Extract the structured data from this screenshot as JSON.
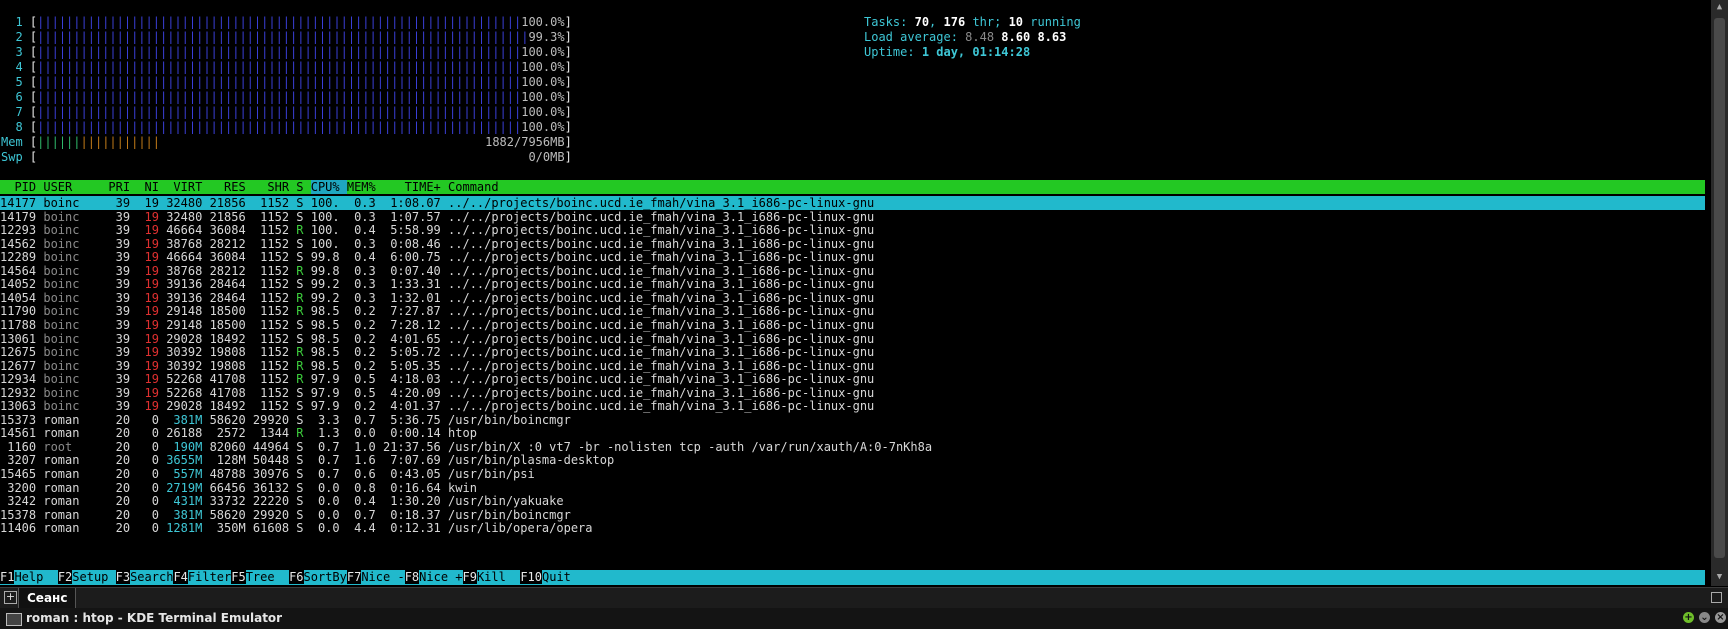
{
  "cpus": [
    {
      "id": "1",
      "pct": "100.0%"
    },
    {
      "id": "2",
      "pct": "99.3%"
    },
    {
      "id": "3",
      "pct": "100.0%"
    },
    {
      "id": "4",
      "pct": "100.0%"
    },
    {
      "id": "5",
      "pct": "100.0%"
    },
    {
      "id": "6",
      "pct": "100.0%"
    },
    {
      "id": "7",
      "pct": "100.0%"
    },
    {
      "id": "8",
      "pct": "100.0%"
    }
  ],
  "mem": {
    "label": "Mem",
    "value": "1882/7956MB",
    "fraction": 0.2366
  },
  "swp": {
    "label": "Swp",
    "value": "0/0MB",
    "fraction": 0
  },
  "summary": {
    "tasks_label": "Tasks:",
    "tasks": "70",
    "thr_sep": ",",
    "thr": "176",
    "thr_label": "thr;",
    "running": "10",
    "running_label": "running",
    "load_label": "Load average:",
    "load1": "8.48",
    "load5": "8.60",
    "load15": "8.63",
    "uptime_label": "Uptime:",
    "uptime": "1 day, 01:14:28"
  },
  "columns": [
    "PID",
    "USER",
    "PRI",
    "NI",
    "VIRT",
    "RES",
    "SHR",
    "S",
    "CPU%",
    "MEM%",
    "TIME+",
    "Command"
  ],
  "processes": [
    {
      "pid": "14177",
      "user": "boinc",
      "pri": "39",
      "ni": "19",
      "virt": "32480",
      "res": "21856",
      "shr": "1152",
      "s": "S",
      "cpu": "100.",
      "mem": "0.3",
      "time": "1:08.07",
      "cmd": "../../projects/boinc.ucd.ie_fmah/vina_3.1_i686-pc-linux-gnu"
    },
    {
      "pid": "14179",
      "user": "boinc",
      "pri": "39",
      "ni": "19",
      "virt": "32480",
      "res": "21856",
      "shr": "1152",
      "s": "S",
      "cpu": "100.",
      "mem": "0.3",
      "time": "1:07.57",
      "cmd": "../../projects/boinc.ucd.ie_fmah/vina_3.1_i686-pc-linux-gnu"
    },
    {
      "pid": "12293",
      "user": "boinc",
      "pri": "39",
      "ni": "19",
      "virt": "46664",
      "res": "36084",
      "shr": "1152",
      "s": "R",
      "cpu": "100.",
      "mem": "0.4",
      "time": "5:58.99",
      "cmd": "../../projects/boinc.ucd.ie_fmah/vina_3.1_i686-pc-linux-gnu"
    },
    {
      "pid": "14562",
      "user": "boinc",
      "pri": "39",
      "ni": "19",
      "virt": "38768",
      "res": "28212",
      "shr": "1152",
      "s": "S",
      "cpu": "100.",
      "mem": "0.3",
      "time": "0:08.46",
      "cmd": "../../projects/boinc.ucd.ie_fmah/vina_3.1_i686-pc-linux-gnu"
    },
    {
      "pid": "12289",
      "user": "boinc",
      "pri": "39",
      "ni": "19",
      "virt": "46664",
      "res": "36084",
      "shr": "1152",
      "s": "S",
      "cpu": "99.8",
      "mem": "0.4",
      "time": "6:00.75",
      "cmd": "../../projects/boinc.ucd.ie_fmah/vina_3.1_i686-pc-linux-gnu"
    },
    {
      "pid": "14564",
      "user": "boinc",
      "pri": "39",
      "ni": "19",
      "virt": "38768",
      "res": "28212",
      "shr": "1152",
      "s": "R",
      "cpu": "99.8",
      "mem": "0.3",
      "time": "0:07.40",
      "cmd": "../../projects/boinc.ucd.ie_fmah/vina_3.1_i686-pc-linux-gnu"
    },
    {
      "pid": "14052",
      "user": "boinc",
      "pri": "39",
      "ni": "19",
      "virt": "39136",
      "res": "28464",
      "shr": "1152",
      "s": "S",
      "cpu": "99.2",
      "mem": "0.3",
      "time": "1:33.31",
      "cmd": "../../projects/boinc.ucd.ie_fmah/vina_3.1_i686-pc-linux-gnu"
    },
    {
      "pid": "14054",
      "user": "boinc",
      "pri": "39",
      "ni": "19",
      "virt": "39136",
      "res": "28464",
      "shr": "1152",
      "s": "R",
      "cpu": "99.2",
      "mem": "0.3",
      "time": "1:32.01",
      "cmd": "../../projects/boinc.ucd.ie_fmah/vina_3.1_i686-pc-linux-gnu"
    },
    {
      "pid": "11790",
      "user": "boinc",
      "pri": "39",
      "ni": "19",
      "virt": "29148",
      "res": "18500",
      "shr": "1152",
      "s": "R",
      "cpu": "98.5",
      "mem": "0.2",
      "time": "7:27.87",
      "cmd": "../../projects/boinc.ucd.ie_fmah/vina_3.1_i686-pc-linux-gnu"
    },
    {
      "pid": "11788",
      "user": "boinc",
      "pri": "39",
      "ni": "19",
      "virt": "29148",
      "res": "18500",
      "shr": "1152",
      "s": "S",
      "cpu": "98.5",
      "mem": "0.2",
      "time": "7:28.12",
      "cmd": "../../projects/boinc.ucd.ie_fmah/vina_3.1_i686-pc-linux-gnu"
    },
    {
      "pid": "13061",
      "user": "boinc",
      "pri": "39",
      "ni": "19",
      "virt": "29028",
      "res": "18492",
      "shr": "1152",
      "s": "S",
      "cpu": "98.5",
      "mem": "0.2",
      "time": "4:01.65",
      "cmd": "../../projects/boinc.ucd.ie_fmah/vina_3.1_i686-pc-linux-gnu"
    },
    {
      "pid": "12675",
      "user": "boinc",
      "pri": "39",
      "ni": "19",
      "virt": "30392",
      "res": "19808",
      "shr": "1152",
      "s": "R",
      "cpu": "98.5",
      "mem": "0.2",
      "time": "5:05.72",
      "cmd": "../../projects/boinc.ucd.ie_fmah/vina_3.1_i686-pc-linux-gnu"
    },
    {
      "pid": "12677",
      "user": "boinc",
      "pri": "39",
      "ni": "19",
      "virt": "30392",
      "res": "19808",
      "shr": "1152",
      "s": "R",
      "cpu": "98.5",
      "mem": "0.2",
      "time": "5:05.35",
      "cmd": "../../projects/boinc.ucd.ie_fmah/vina_3.1_i686-pc-linux-gnu"
    },
    {
      "pid": "12934",
      "user": "boinc",
      "pri": "39",
      "ni": "19",
      "virt": "52268",
      "res": "41708",
      "shr": "1152",
      "s": "R",
      "cpu": "97.9",
      "mem": "0.5",
      "time": "4:18.03",
      "cmd": "../../projects/boinc.ucd.ie_fmah/vina_3.1_i686-pc-linux-gnu"
    },
    {
      "pid": "12932",
      "user": "boinc",
      "pri": "39",
      "ni": "19",
      "virt": "52268",
      "res": "41708",
      "shr": "1152",
      "s": "S",
      "cpu": "97.9",
      "mem": "0.5",
      "time": "4:20.09",
      "cmd": "../../projects/boinc.ucd.ie_fmah/vina_3.1_i686-pc-linux-gnu"
    },
    {
      "pid": "13063",
      "user": "boinc",
      "pri": "39",
      "ni": "19",
      "virt": "29028",
      "res": "18492",
      "shr": "1152",
      "s": "S",
      "cpu": "97.9",
      "mem": "0.2",
      "time": "4:01.37",
      "cmd": "../../projects/boinc.ucd.ie_fmah/vina_3.1_i686-pc-linux-gnu"
    },
    {
      "pid": "15373",
      "user": "roman",
      "pri": "20",
      "ni": "0",
      "virt": "381M",
      "res": "58620",
      "shr": "29920",
      "s": "S",
      "cpu": "3.3",
      "mem": "0.7",
      "time": "5:36.75",
      "cmd": "/usr/bin/boincmgr"
    },
    {
      "pid": "14561",
      "user": "roman",
      "pri": "20",
      "ni": "0",
      "virt": "26188",
      "res": "2572",
      "shr": "1344",
      "s": "R",
      "cpu": "1.3",
      "mem": "0.0",
      "time": "0:00.14",
      "cmd": "htop"
    },
    {
      "pid": "1160",
      "user": "root",
      "pri": "20",
      "ni": "0",
      "virt": "190M",
      "res": "82060",
      "shr": "44964",
      "s": "S",
      "cpu": "0.7",
      "mem": "1.0",
      "time": "21:37.56",
      "cmd": "/usr/bin/X :0 vt7 -br -nolisten tcp -auth /var/run/xauth/A:0-7nKh8a"
    },
    {
      "pid": "3207",
      "user": "roman",
      "pri": "20",
      "ni": "0",
      "virt": "3655M",
      "res": "128M",
      "shr": "50448",
      "s": "S",
      "cpu": "0.7",
      "mem": "1.6",
      "time": "7:07.69",
      "cmd": "/usr/bin/plasma-desktop"
    },
    {
      "pid": "15465",
      "user": "roman",
      "pri": "20",
      "ni": "0",
      "virt": "557M",
      "res": "48788",
      "shr": "30976",
      "s": "S",
      "cpu": "0.7",
      "mem": "0.6",
      "time": "0:43.05",
      "cmd": "/usr/bin/psi"
    },
    {
      "pid": "3200",
      "user": "roman",
      "pri": "20",
      "ni": "0",
      "virt": "2719M",
      "res": "66456",
      "shr": "36132",
      "s": "S",
      "cpu": "0.0",
      "mem": "0.8",
      "time": "0:16.64",
      "cmd": "kwin"
    },
    {
      "pid": "3242",
      "user": "roman",
      "pri": "20",
      "ni": "0",
      "virt": "431M",
      "res": "33732",
      "shr": "22220",
      "s": "S",
      "cpu": "0.0",
      "mem": "0.4",
      "time": "1:30.20",
      "cmd": "/usr/bin/yakuake"
    },
    {
      "pid": "15378",
      "user": "roman",
      "pri": "20",
      "ni": "0",
      "virt": "381M",
      "res": "58620",
      "shr": "29920",
      "s": "S",
      "cpu": "0.0",
      "mem": "0.7",
      "time": "0:18.37",
      "cmd": "/usr/bin/boincmgr"
    },
    {
      "pid": "11406",
      "user": "roman",
      "pri": "20",
      "ni": "0",
      "virt": "1281M",
      "res": "350M",
      "shr": "61608",
      "s": "S",
      "cpu": "0.0",
      "mem": "4.4",
      "time": "0:12.31",
      "cmd": "/usr/lib/opera/opera"
    }
  ],
  "footer": [
    {
      "key": "F1",
      "label": "Help  "
    },
    {
      "key": "F2",
      "label": "Setup "
    },
    {
      "key": "F3",
      "label": "Search"
    },
    {
      "key": "F4",
      "label": "Filter"
    },
    {
      "key": "F5",
      "label": "Tree  "
    },
    {
      "key": "F6",
      "label": "SortBy"
    },
    {
      "key": "F7",
      "label": "Nice -"
    },
    {
      "key": "F8",
      "label": "Nice +"
    },
    {
      "key": "F9",
      "label": "Kill  "
    },
    {
      "key": "F10",
      "label": "Quit  "
    }
  ],
  "tab": {
    "label": "Сеанс"
  },
  "window": {
    "title": "roman : htop - KDE Terminal Emulator"
  },
  "colors": {
    "header": "#23c823",
    "selection": "#21b9cc",
    "bar": "#3a3fd6",
    "nice": "#e03030",
    "running": "#3ccc3c"
  }
}
